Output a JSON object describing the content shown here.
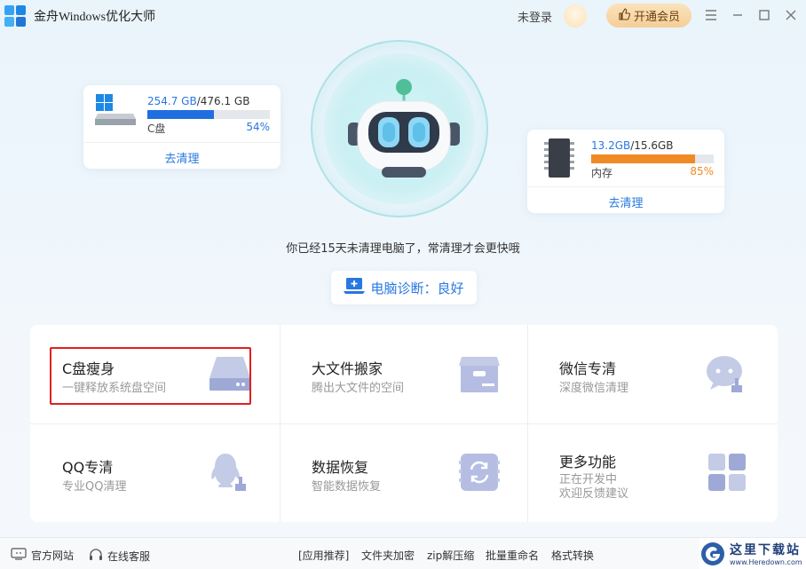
{
  "app": {
    "title": "金舟Windows优化大师"
  },
  "header": {
    "login_text": "未登录",
    "vip_label": "开通会员"
  },
  "disk": {
    "used": "254.7 GB",
    "separator_total": "/476.1 GB",
    "label": "C盘",
    "percent": "54%",
    "fill": 0.54,
    "clean_label": "去清理",
    "bar_color": "#1f6fe0"
  },
  "memory": {
    "used": "13.2GB",
    "separator_total": "/15.6GB",
    "label": "内存",
    "percent": "85%",
    "fill": 0.85,
    "clean_label": "去清理",
    "bar_color": "#f08a24"
  },
  "hint": "你已经15天未清理电脑了，常清理才会更快哦",
  "diagnosis": {
    "label": "电脑诊断：良好"
  },
  "features": [
    {
      "title": "C盘瘦身",
      "subtitle": "一键释放系统盘空间",
      "icon": "disk-icon"
    },
    {
      "title": "大文件搬家",
      "subtitle": "腾出大文件的空间",
      "icon": "box-icon"
    },
    {
      "title": "微信专清",
      "subtitle": "深度微信清理",
      "icon": "wechat-clean-icon"
    },
    {
      "title": "QQ专清",
      "subtitle": "专业QQ清理",
      "icon": "qq-clean-icon"
    },
    {
      "title": "数据恢复",
      "subtitle": "智能数据恢复",
      "icon": "recovery-icon"
    },
    {
      "title": "更多功能",
      "subtitle": "正在开发中",
      "subtitle2": "欢迎反馈建议",
      "icon": "grid-icon"
    }
  ],
  "footer": {
    "website": "官方网站",
    "support": "在线客服",
    "recommend": "[应用推荐]",
    "links": [
      "文件夹加密",
      "zip解压缩",
      "批量重命名",
      "格式转换"
    ]
  },
  "watermark": {
    "cn": "这里下载站",
    "en": "www.Heredown.com"
  },
  "colors": {
    "accent": "#2878e0",
    "highlight_border": "#e02020"
  }
}
